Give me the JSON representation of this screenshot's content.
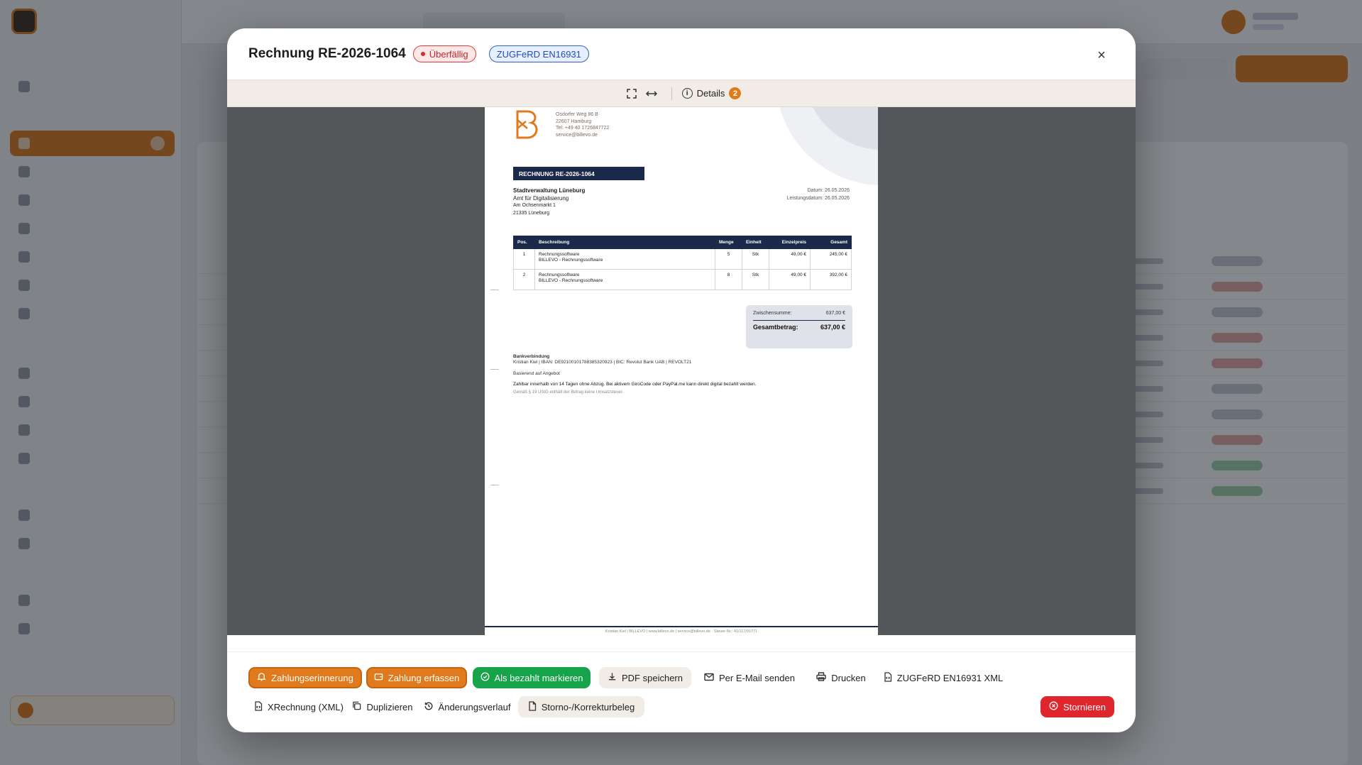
{
  "modal": {
    "title": "Rechnung RE-2026-1064",
    "status_badge": "Überfällig",
    "format_badge": "ZUGFeRD EN16931",
    "close_label": "×"
  },
  "viewer": {
    "details_label": "Details",
    "details_count": "2"
  },
  "invoice": {
    "sender_address": [
      "Osdorfer Weg 86 B",
      "22607 Hamburg",
      "Tel: +49 40 1726847722",
      "service@billevo.de"
    ],
    "banner": "RECHNUNG RE-2026-1064",
    "recipient": {
      "name": "Stadtverwaltung Lüneburg",
      "dept": "Amt für Digitalisierung",
      "street": "Am Ochsenmarkt 1",
      "city": "21335 Lüneburg"
    },
    "date_label": "Datum:",
    "date_value": "26.05.2026",
    "service_date_label": "Leistungsdatum:",
    "service_date_value": "26.05.2026",
    "table_headers": [
      "Pos.",
      "Beschreibung",
      "Menge",
      "Einheit",
      "Einzelpreis",
      "Gesamt"
    ],
    "rows": [
      {
        "pos": "1",
        "desc1": "Rechnungssoftware",
        "desc2": "BILLEVO - Rechnungssoftware",
        "qty": "5",
        "unit": "Stk",
        "price": "49,00 €",
        "total": "245,00 €"
      },
      {
        "pos": "2",
        "desc1": "Rechnungssoftware",
        "desc2": "BILLEVO - Rechnungssoftware",
        "qty": "8",
        "unit": "Stk",
        "price": "49,00 €",
        "total": "392,00 €"
      }
    ],
    "subtotal_label": "Zwischensumme:",
    "subtotal_value": "637,00 €",
    "total_label": "Gesamtbetrag:",
    "total_value": "637,00 €",
    "bank_heading": "Bankverbindung",
    "bank_line": "Kristian Kiel | IBAN: DE92100101788385320923 | BIC: Revolut Bank UAB | REVOLT21",
    "note_offer": "Basierend auf Angebot",
    "note_payment": "Zahlbar innerhalb von 14 Tagen ohne Abzug. Bei aktivem GiroCode oder PayPal.me kann direkt digital bezahlt werden.",
    "note_tax": "Gemäß § 19 UStG enthält der Betrag keine Umsatzsteuer.",
    "footer": "Kristian Kiel | BILLEVO | www.billevo.de | service@billevo.de · Steuer-Nr.: 41/117/01771"
  },
  "actions": {
    "reminder": "Zahlungserinnerung",
    "record_payment": "Zahlung erfassen",
    "mark_paid": "Als bezahlt markieren",
    "save_pdf": "PDF speichern",
    "send_email": "Per E-Mail senden",
    "print": "Drucken",
    "zugferd_xml": "ZUGFeRD EN16931 XML",
    "xrechnung": "XRechnung (XML)",
    "duplicate": "Duplizieren",
    "history": "Änderungsverlauf",
    "correction": "Storno-/Korrekturbeleg",
    "cancel": "Stornieren"
  },
  "colors": {
    "accent": "#e07a1c",
    "success": "#16a34a",
    "danger": "#e0262d",
    "navy": "#1b2a4a"
  }
}
